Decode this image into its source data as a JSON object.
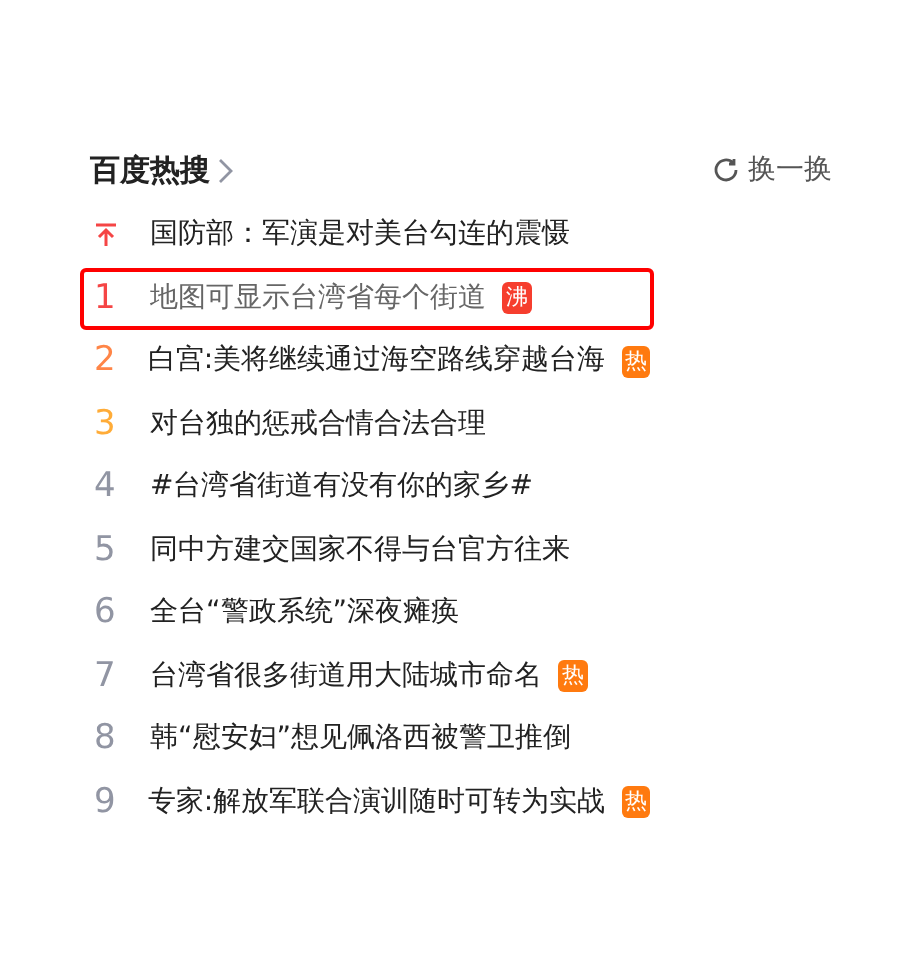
{
  "header": {
    "title": "百度热搜",
    "refresh": "换一换"
  },
  "items": [
    {
      "kind": "pinned",
      "title": "国防部：军演是对美台勾连的震慑",
      "selected": false
    },
    {
      "kind": "ranked",
      "rank": "1",
      "color": "#f54545",
      "title": "地图可显示台湾省每个街道",
      "badge": {
        "text": "沸",
        "kind": "boil"
      },
      "selected": true
    },
    {
      "kind": "ranked",
      "rank": "2",
      "color": "#ff8547",
      "title": "白宫:美将继续通过海空路线穿越台海",
      "badge": {
        "text": "热",
        "kind": "hot"
      },
      "selected": false
    },
    {
      "kind": "ranked",
      "rank": "3",
      "color": "#ffac38",
      "title": "对台独的惩戒合情合法合理",
      "selected": false
    },
    {
      "kind": "ranked",
      "rank": "4",
      "color": "#9195a3",
      "title": "#台湾省街道有没有你的家乡#",
      "selected": false
    },
    {
      "kind": "ranked",
      "rank": "5",
      "color": "#9195a3",
      "title": "同中方建交国家不得与台官方往来",
      "selected": false
    },
    {
      "kind": "ranked",
      "rank": "6",
      "color": "#9195a3",
      "title": "全台“警政系统”深夜瘫痪",
      "selected": false
    },
    {
      "kind": "ranked",
      "rank": "7",
      "color": "#9195a3",
      "title": "台湾省很多街道用大陆城市命名",
      "badge": {
        "text": "热",
        "kind": "hot"
      },
      "selected": false
    },
    {
      "kind": "ranked",
      "rank": "8",
      "color": "#9195a3",
      "title": "韩“慰安妇”想见佩洛西被警卫推倒",
      "selected": false
    },
    {
      "kind": "ranked",
      "rank": "9",
      "color": "#9195a3",
      "title": "专家:解放军联合演训随时可转为实战",
      "badge": {
        "text": "热",
        "kind": "hot"
      },
      "selected": false
    }
  ]
}
